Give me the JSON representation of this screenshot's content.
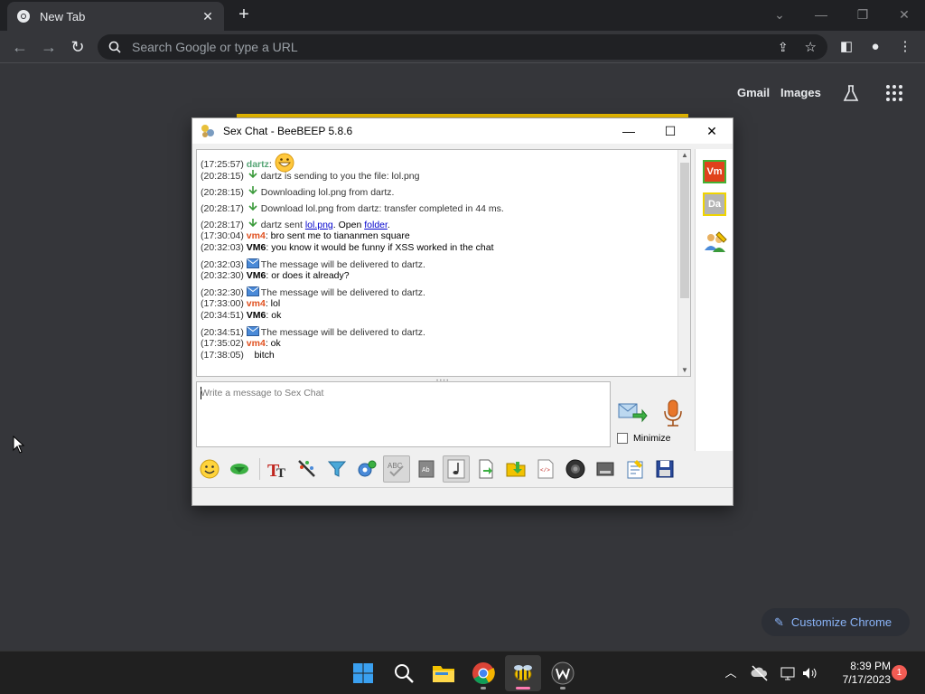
{
  "browser": {
    "tab_title": "New Tab",
    "omnibox_placeholder": "Search Google or type a URL"
  },
  "ntp": {
    "gmail": "Gmail",
    "images": "Images",
    "customize": "Customize Chrome"
  },
  "beebeep": {
    "title": "Sex Chat - BeeBEEP 5.8.6",
    "messages": [
      {
        "ts": "(17:25:57)",
        "user": "dartz",
        "text": ": "
      },
      {
        "ts": "(20:28:15)",
        "text": "dartz is sending to you the file: lol.png"
      },
      {
        "ts": "(20:28:15)",
        "text": "Downloading lol.png from dartz."
      },
      {
        "ts": "(20:28:17)",
        "text": "Download lol.png from dartz: transfer completed in 44 ms."
      },
      {
        "ts": "(20:28:17)",
        "text_pre": "dartz sent ",
        "link1": "lol.png",
        "text_mid": ". Open ",
        "link2": "folder",
        "text_post": "."
      },
      {
        "ts": "(17:30:04)",
        "user": "vm4",
        "text": ": bro sent me to tiananmen square"
      },
      {
        "ts": "(20:32:03)",
        "user": "VM6",
        "text": ": you know it would be funny if XSS worked in the chat"
      },
      {
        "ts": "(20:32:03)",
        "text": "The message will be delivered to dartz."
      },
      {
        "ts": "(20:32:30)",
        "user": "VM6",
        "text": ": or does it already?"
      },
      {
        "ts": "(20:32:30)",
        "text": "The message will be delivered to dartz."
      },
      {
        "ts": "(17:33:00)",
        "user": "vm4",
        "text": ": lol"
      },
      {
        "ts": "(20:34:51)",
        "user": "VM6",
        "text": ": ok"
      },
      {
        "ts": "(20:34:51)",
        "text": "The message will be delivered to dartz."
      },
      {
        "ts": "(17:35:02)",
        "user": "vm4",
        "text": ": ok"
      },
      {
        "ts": "(17:38:05)",
        "text": "   bitch"
      }
    ],
    "input_placeholder": "Write a message to Sex Chat",
    "minimize_label": "Minimize",
    "users": [
      {
        "initials": "Vm"
      },
      {
        "initials": "Da"
      }
    ]
  },
  "taskbar": {
    "time": "8:39 PM",
    "date": "7/17/2023",
    "notifications": "1"
  }
}
